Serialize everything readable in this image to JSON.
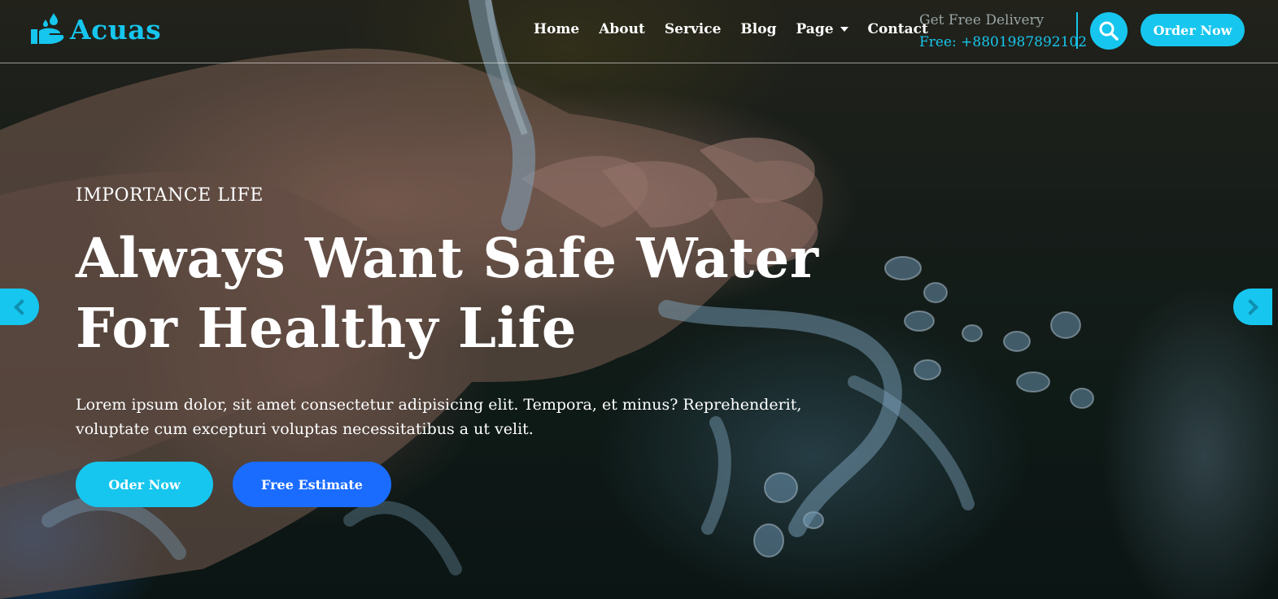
{
  "brand": {
    "name": "Acuas",
    "logo_icon": "hand-water-drops-icon",
    "accent_color": "#16c6ee",
    "secondary_color": "#1a6cff"
  },
  "nav": {
    "items": [
      {
        "label": "Home"
      },
      {
        "label": "About"
      },
      {
        "label": "Service"
      },
      {
        "label": "Blog"
      },
      {
        "label": "Page",
        "has_dropdown": true
      },
      {
        "label": "Contact"
      }
    ]
  },
  "delivery": {
    "title": "Get Free Delivery",
    "phone": "Free: +8801987892102"
  },
  "header": {
    "search_icon": "search-icon",
    "order_label": "Order Now"
  },
  "hero": {
    "eyebrow": "IMPORTANCE LIFE",
    "headline_line1": "Always Want Safe Water",
    "headline_line2": "For Healthy Life",
    "description": "Lorem ipsum dolor, sit amet consectetur adipisicing elit. Tempora, et minus? Reprehenderit, voluptate cum excepturi voluptas necessitatibus a ut velit.",
    "primary_button": "Oder Now",
    "secondary_button": "Free Estimate"
  },
  "slider": {
    "prev_icon": "chevron-left-icon",
    "next_icon": "chevron-right-icon"
  }
}
